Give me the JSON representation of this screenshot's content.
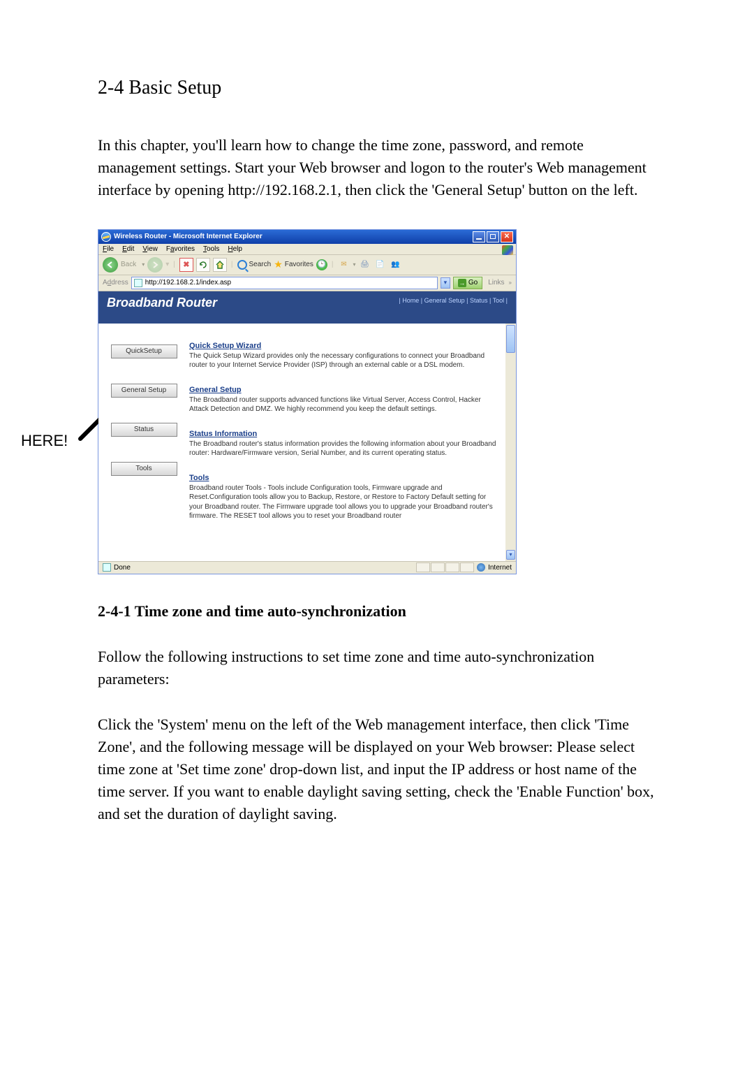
{
  "doc": {
    "section_title": "2-4 Basic Setup",
    "intro": "In this chapter, you'll learn how to change the time zone, password, and remote management settings. Start your Web browser and logon to the router's Web management interface by opening http://192.168.2.1, then click the 'General Setup' button on the left.",
    "here_label": "HERE!",
    "sub_title": "2-4-1 Time zone and time auto-synchronization",
    "para2": "Follow the following instructions to set time zone and time auto-synchronization parameters:",
    "para3": "Click the 'System' menu on the left of the Web management interface, then click 'Time Zone', and the following message will be displayed on your Web browser: Please select time zone at 'Set time zone' drop-down list, and input the IP address or host name of the time server. If you want to enable daylight saving setting, check the 'Enable Function' box, and set the duration of daylight saving."
  },
  "ie": {
    "title": "Wireless Router - Microsoft Internet Explorer",
    "menu": {
      "file": "File",
      "edit": "Edit",
      "view": "View",
      "favorites": "Favorites",
      "tools": "Tools",
      "help": "Help"
    },
    "toolbar": {
      "back_label": "Back",
      "search": "Search",
      "favorites": "Favorites"
    },
    "address": {
      "label": "Address",
      "url": "http://192.168.2.1/index.asp",
      "go": "Go",
      "links": "Links"
    },
    "status_done": "Done",
    "status_zone": "Internet"
  },
  "router": {
    "banner_title": "Broadband Router",
    "banner_links": "| Home | General Setup | Status | Tool |",
    "buttons": {
      "quick": "QuickSetup",
      "general": "General Setup",
      "status": "Status",
      "tools": "Tools"
    },
    "sections": {
      "quick": {
        "title": "Quick Setup Wizard",
        "body": "The Quick Setup Wizard provides only the necessary configurations to connect your Broadband router to your Internet Service Provider (ISP) through an external cable or a DSL modem."
      },
      "general": {
        "title": "General Setup",
        "body": "The Broadband router supports advanced functions like Virtual Server, Access Control, Hacker Attack Detection and DMZ. We highly recommend you keep the default settings."
      },
      "status": {
        "title": "Status Information",
        "body": "The Broadband router's status information provides the following information about your Broadband router: Hardware/Firmware version, Serial Number, and its current operating status."
      },
      "tools": {
        "title": "Tools",
        "body": "Broadband router Tools - Tools include Configuration tools, Firmware upgrade and Reset.Configuration tools allow you to Backup, Restore, or Restore to Factory Default setting for your Broadband router. The Firmware upgrade tool allows you to upgrade your Broadband router's firmware. The RESET tool allows you to reset your Broadband router"
      }
    }
  }
}
